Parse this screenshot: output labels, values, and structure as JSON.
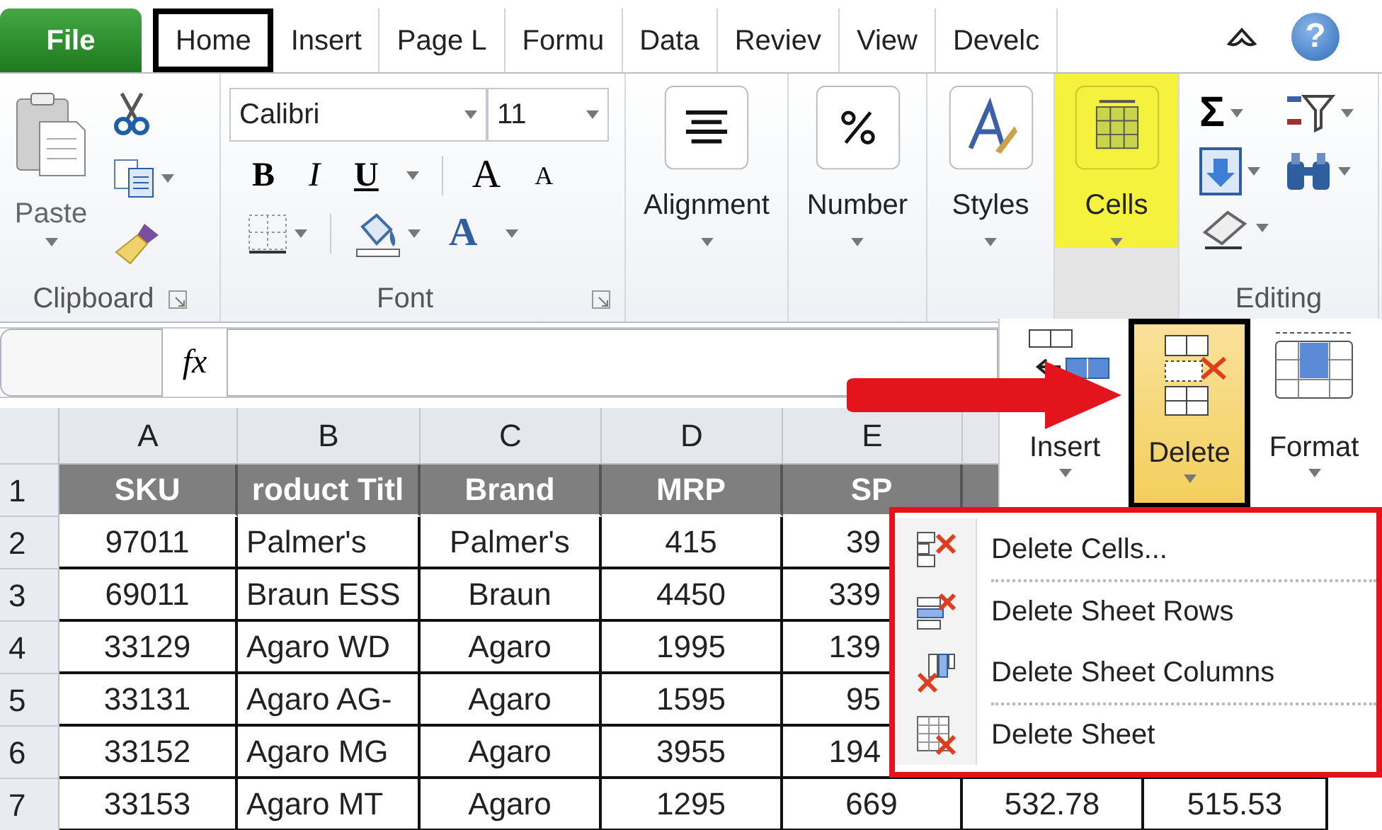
{
  "tabs": [
    {
      "label": "File",
      "kind": "file",
      "selected": false
    },
    {
      "label": "Home",
      "kind": "tab",
      "selected": true
    },
    {
      "label": "Insert",
      "kind": "tab",
      "selected": false
    },
    {
      "label": "Page L",
      "kind": "tab",
      "selected": false
    },
    {
      "label": "Formu",
      "kind": "tab",
      "selected": false
    },
    {
      "label": "Data",
      "kind": "tab",
      "selected": false
    },
    {
      "label": "Reviev",
      "kind": "tab",
      "selected": false
    },
    {
      "label": "View",
      "kind": "tab",
      "selected": false
    },
    {
      "label": "Develc",
      "kind": "tab",
      "selected": false
    }
  ],
  "window_controls": {
    "help": "?"
  },
  "ribbon": {
    "clipboard": {
      "paste": "Paste",
      "label": "Clipboard"
    },
    "font": {
      "name": "Calibri",
      "size": "11",
      "label": "Font",
      "buttons": [
        {
          "kind": "bold",
          "label": "B"
        },
        {
          "kind": "italic",
          "label": "I"
        },
        {
          "kind": "underline",
          "label": "U"
        },
        {
          "kind": "grow",
          "label": "A"
        },
        {
          "kind": "shrink",
          "label": "A"
        },
        {
          "kind": "color",
          "label": "A"
        }
      ]
    },
    "groups": [
      {
        "kind": "alignment",
        "label": "Alignment",
        "highlighted": false
      },
      {
        "kind": "number",
        "label": "Number",
        "highlighted": false
      },
      {
        "kind": "styles",
        "label": "Styles",
        "highlighted": false
      },
      {
        "kind": "cells",
        "label": "Cells",
        "highlighted": true
      }
    ],
    "editing": {
      "autosum": "Σ",
      "label": "Editing"
    }
  },
  "formula_bar": {
    "function_symbol": "fx"
  },
  "grid": {
    "columns": [
      "A",
      "B",
      "C",
      "D",
      "E"
    ],
    "rows": [
      {
        "number": "1",
        "kind": "header",
        "cells": [
          "SKU",
          "roduct Titl",
          "Brand",
          "MRP",
          "SP"
        ]
      },
      {
        "number": "2",
        "kind": "data",
        "cells": [
          "97011",
          "Palmer's",
          "Palmer's",
          "415",
          "39"
        ]
      },
      {
        "number": "3",
        "kind": "data",
        "cells": [
          "69011",
          "Braun ESS",
          "Braun",
          "4450",
          "339"
        ]
      },
      {
        "number": "4",
        "kind": "data",
        "cells": [
          "33129",
          "Agaro WD",
          "Agaro",
          "1995",
          "139"
        ]
      },
      {
        "number": "5",
        "kind": "data",
        "cells": [
          "33131",
          "Agaro AG-",
          "Agaro",
          "1595",
          "95"
        ]
      },
      {
        "number": "6",
        "kind": "data",
        "cells": [
          "33152",
          "Agaro MG",
          "Agaro",
          "3955",
          "194"
        ]
      },
      {
        "number": "7",
        "kind": "data",
        "cells": [
          "33153",
          "Agaro MT",
          "Agaro",
          "1295",
          "669",
          "532.78",
          "515.53"
        ]
      }
    ]
  },
  "cells_panel": {
    "buttons": [
      {
        "kind": "insert",
        "label": "Insert",
        "selected": false
      },
      {
        "kind": "delete",
        "label": "Delete",
        "selected": true
      },
      {
        "kind": "format",
        "label": "Format",
        "selected": false
      }
    ]
  },
  "menu": {
    "items": [
      {
        "kind": "cells",
        "label": "Delete Cells...",
        "separator_after": true
      },
      {
        "kind": "rows",
        "label": "Delete Sheet Rows",
        "separator_after": false
      },
      {
        "kind": "columns",
        "label": "Delete Sheet Columns",
        "separator_after": true
      },
      {
        "kind": "sheet",
        "label": "Delete Sheet",
        "separator_after": false
      }
    ]
  }
}
